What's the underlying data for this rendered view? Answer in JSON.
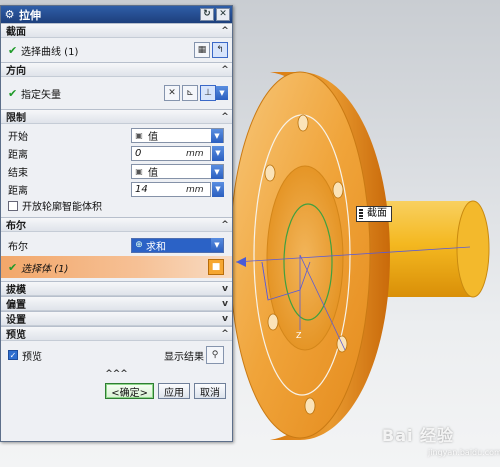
{
  "dialog": {
    "title": "拉伸",
    "title_buttons": {
      "reset": "↻",
      "close": "✕"
    }
  },
  "sections": {
    "section": {
      "label": "截面",
      "select_curve": "选择曲线 (1)"
    },
    "direction": {
      "label": "方向",
      "specify_vector": "指定矢量"
    },
    "limits": {
      "label": "限制",
      "start_label": "开始",
      "start_value": "值",
      "start_distance_label": "距离",
      "start_distance_value": "0",
      "end_label": "结束",
      "end_value": "值",
      "end_distance_label": "距离",
      "end_distance_value": "14",
      "unit": "mm",
      "open_profile_label": "开放轮廓智能体积"
    },
    "boolean": {
      "label": "布尔",
      "boolean_label": "布尔",
      "boolean_value": "求和",
      "select_body": "选择体 (1)"
    },
    "draft": {
      "label": "拔模"
    },
    "offset": {
      "label": "偏置"
    },
    "settings": {
      "label": "设置"
    },
    "preview": {
      "label": "预览",
      "preview_checkbox": "预览",
      "show_result": "显示结果"
    }
  },
  "footer": {
    "ok": "<确定>",
    "apply": "应用",
    "cancel": "取消"
  },
  "viewport": {
    "tooltip": "截面",
    "axis_label": "Z",
    "watermark": "Bai 经验",
    "watermark_url": "jingyan.baidu.com"
  },
  "colors": {
    "part": "#f0a020",
    "title_bar": "#2f5ea8",
    "selected_body_row": "#f2a76a"
  }
}
